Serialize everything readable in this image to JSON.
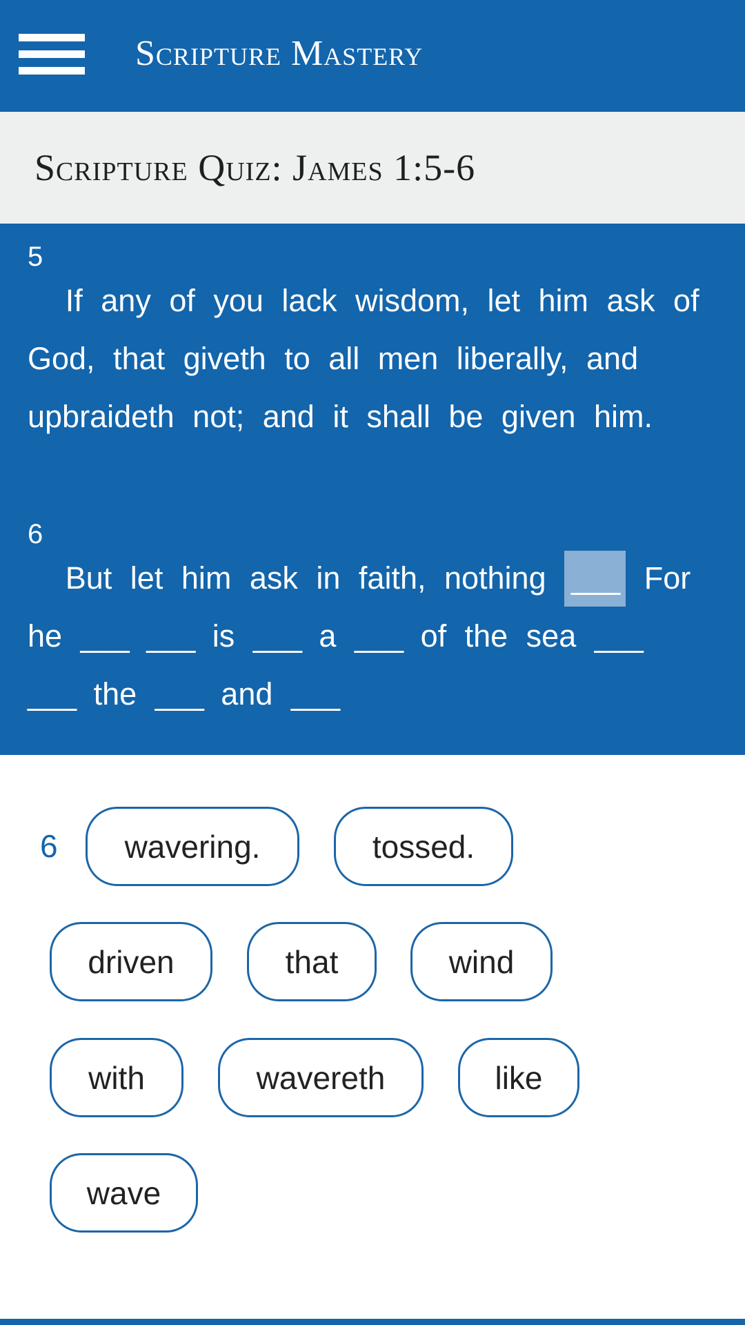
{
  "header": {
    "menu_icon": "hamburger-menu-icon",
    "title": "Scripture Mastery"
  },
  "quiz": {
    "title": "Scripture Quiz: James 1:5-6"
  },
  "colors": {
    "primary": "#1365ac",
    "title_band": "#eeefef",
    "active_blank": "#8ab0d6",
    "chip_border": "#1b66a8"
  },
  "verses": [
    {
      "number": "5",
      "text": "If any of you lack wisdom, let him ask of God, that giveth to all men liberally, and upbraideth not; and it shall be given him."
    },
    {
      "number": "6",
      "segments": [
        {
          "type": "text",
          "value": "But let him ask in faith, nothing"
        },
        {
          "type": "blank",
          "value": "___",
          "active": true
        },
        {
          "type": "text",
          "value": "For he"
        },
        {
          "type": "blank",
          "value": "___"
        },
        {
          "type": "blank",
          "value": "___"
        },
        {
          "type": "text",
          "value": "is"
        },
        {
          "type": "blank",
          "value": "___"
        },
        {
          "type": "text",
          "value": "a"
        },
        {
          "type": "blank",
          "value": "___"
        },
        {
          "type": "text",
          "value": "of the sea"
        },
        {
          "type": "blank",
          "value": "___"
        },
        {
          "type": "blank",
          "value": "___"
        },
        {
          "type": "text",
          "value": "the"
        },
        {
          "type": "blank",
          "value": "___"
        },
        {
          "type": "text",
          "value": "and"
        },
        {
          "type": "blank",
          "value": "___"
        }
      ]
    }
  ],
  "word_bank": {
    "verse_number": "6",
    "words": [
      "wavering.",
      "tossed.",
      "driven",
      "that",
      "wind",
      "with",
      "wavereth",
      "like",
      "wave"
    ]
  }
}
